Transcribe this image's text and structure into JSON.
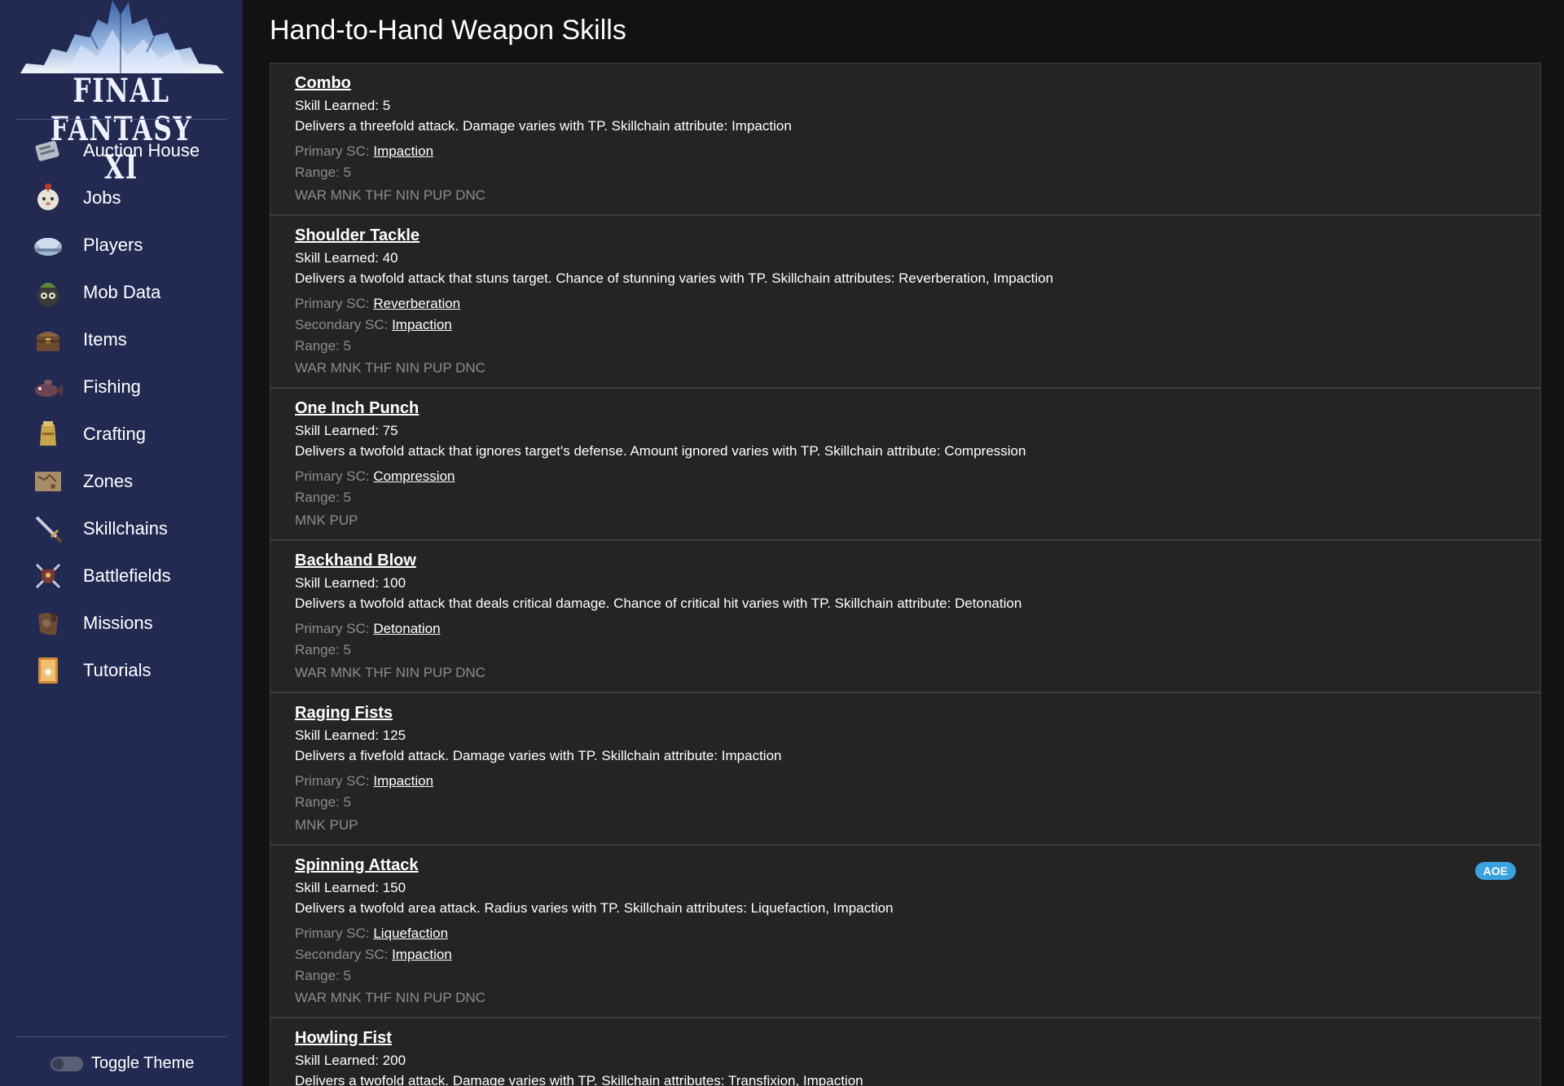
{
  "sidebar": {
    "logo_text": "FINAL FANTASY XI",
    "items": [
      {
        "label": "Auction House",
        "icon": "auction-house-icon"
      },
      {
        "label": "Jobs",
        "icon": "moogle-icon"
      },
      {
        "label": "Players",
        "icon": "helmet-icon"
      },
      {
        "label": "Mob Data",
        "icon": "mob-icon"
      },
      {
        "label": "Items",
        "icon": "treasure-chest-icon"
      },
      {
        "label": "Fishing",
        "icon": "fish-icon"
      },
      {
        "label": "Crafting",
        "icon": "crafting-icon"
      },
      {
        "label": "Zones",
        "icon": "map-icon"
      },
      {
        "label": "Skillchains",
        "icon": "sword-icon"
      },
      {
        "label": "Battlefields",
        "icon": "crossed-swords-shield-icon"
      },
      {
        "label": "Missions",
        "icon": "missions-icon"
      },
      {
        "label": "Tutorials",
        "icon": "scroll-icon"
      }
    ],
    "toggle_label": "Toggle Theme"
  },
  "main": {
    "title": "Hand-to-Hand Weapon Skills",
    "skills": [
      {
        "name": "Combo",
        "skill_learned": "Skill Learned: 5",
        "description": "Delivers a threefold attack. Damage varies with TP. Skillchain attribute: Impaction",
        "primary_label": "Primary SC: ",
        "primary_sc": "Impaction",
        "range": "Range: 5",
        "jobs": "WAR MNK THF NIN PUP DNC"
      },
      {
        "name": "Shoulder Tackle",
        "skill_learned": "Skill Learned: 40",
        "description": "Delivers a twofold attack that stuns target. Chance of stunning varies with TP. Skillchain attributes: Reverberation, Impaction",
        "primary_label": "Primary SC: ",
        "primary_sc": "Reverberation",
        "secondary_label": "Secondary SC: ",
        "secondary_sc": "Impaction",
        "range": "Range: 5",
        "jobs": "WAR MNK THF NIN PUP DNC"
      },
      {
        "name": "One Inch Punch",
        "skill_learned": "Skill Learned: 75",
        "description": "Delivers a twofold attack that ignores target's defense. Amount ignored varies with TP. Skillchain attribute: Compression",
        "primary_label": "Primary SC: ",
        "primary_sc": "Compression",
        "range": "Range: 5",
        "jobs": "MNK PUP"
      },
      {
        "name": "Backhand Blow",
        "skill_learned": "Skill Learned: 100",
        "description": "Delivers a twofold attack that deals critical damage. Chance of critical hit varies with TP. Skillchain attribute: Detonation",
        "primary_label": "Primary SC: ",
        "primary_sc": "Detonation",
        "range": "Range: 5",
        "jobs": "WAR MNK THF NIN PUP DNC"
      },
      {
        "name": "Raging Fists",
        "skill_learned": "Skill Learned: 125",
        "description": "Delivers a fivefold attack. Damage varies with TP. Skillchain attribute: Impaction",
        "primary_label": "Primary SC: ",
        "primary_sc": "Impaction",
        "range": "Range: 5",
        "jobs": "MNK PUP"
      },
      {
        "name": "Spinning Attack",
        "badge": "AOE",
        "skill_learned": "Skill Learned: 150",
        "description": "Delivers a twofold area attack. Radius varies with TP. Skillchain attributes: Liquefaction, Impaction",
        "primary_label": "Primary SC: ",
        "primary_sc": "Liquefaction",
        "secondary_label": "Secondary SC: ",
        "secondary_sc": "Impaction",
        "range": "Range: 5",
        "jobs": "WAR MNK THF NIN PUP DNC"
      },
      {
        "name": "Howling Fist",
        "skill_learned": "Skill Learned: 200",
        "description": "Delivers a twofold attack. Damage varies with TP. Skillchain attributes: Transfixion, Impaction"
      }
    ]
  },
  "colors": {
    "sidebar_bg": "#232a52",
    "page_bg": "#121212",
    "panel_bg": "#242424",
    "badge_bg": "#3aa0e0",
    "muted_text": "#8c8c8c"
  }
}
